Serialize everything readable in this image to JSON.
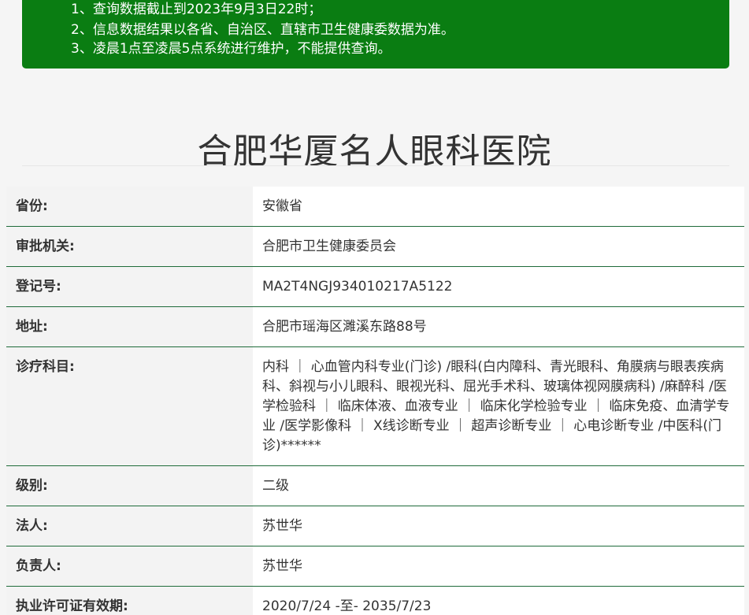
{
  "notice": {
    "lines": [
      "1、查询数据截止到2023年9月3日22时；",
      "2、信息数据结果以各省、自治区、直辖市卫生健康委数据为准。",
      "3、凌晨1点至凌晨5点系统进行维护，不能提供查询。"
    ],
    "background_color": "#0a7d12"
  },
  "hospital": {
    "name": "合肥华厦名人眼科医院"
  },
  "info": {
    "rows": [
      {
        "label": "省份:",
        "value": "安徽省"
      },
      {
        "label": "审批机关:",
        "value": "合肥市卫生健康委员会"
      },
      {
        "label": "登记号:",
        "value": "MA2T4NGJ934010217A5122"
      },
      {
        "label": "地址:",
        "value": "合肥市瑶海区濉溪东路88号"
      },
      {
        "label": "诊疗科目:",
        "value": "内科 ｜ 心血管内科专业(门诊) /眼科(白内障科、青光眼科、角膜病与眼表疾病科、斜视与小儿眼科、眼视光科、屈光手术科、玻璃体视网膜病科) /麻醉科 /医学检验科 ｜ 临床体液、血液专业 ｜ 临床化学检验专业 ｜ 临床免疫、血清学专业 /医学影像科 ｜ X线诊断专业 ｜ 超声诊断专业 ｜ 心电诊断专业 /中医科(门诊)******"
      },
      {
        "label": "级别:",
        "value": "二级"
      },
      {
        "label": "法人:",
        "value": "苏世华"
      },
      {
        "label": "负责人:",
        "value": "苏世华"
      },
      {
        "label": "执业许可证有效期:",
        "value": "2020/7/24 -至- 2035/7/23"
      }
    ],
    "row_border_color": "#1f6b3a"
  }
}
